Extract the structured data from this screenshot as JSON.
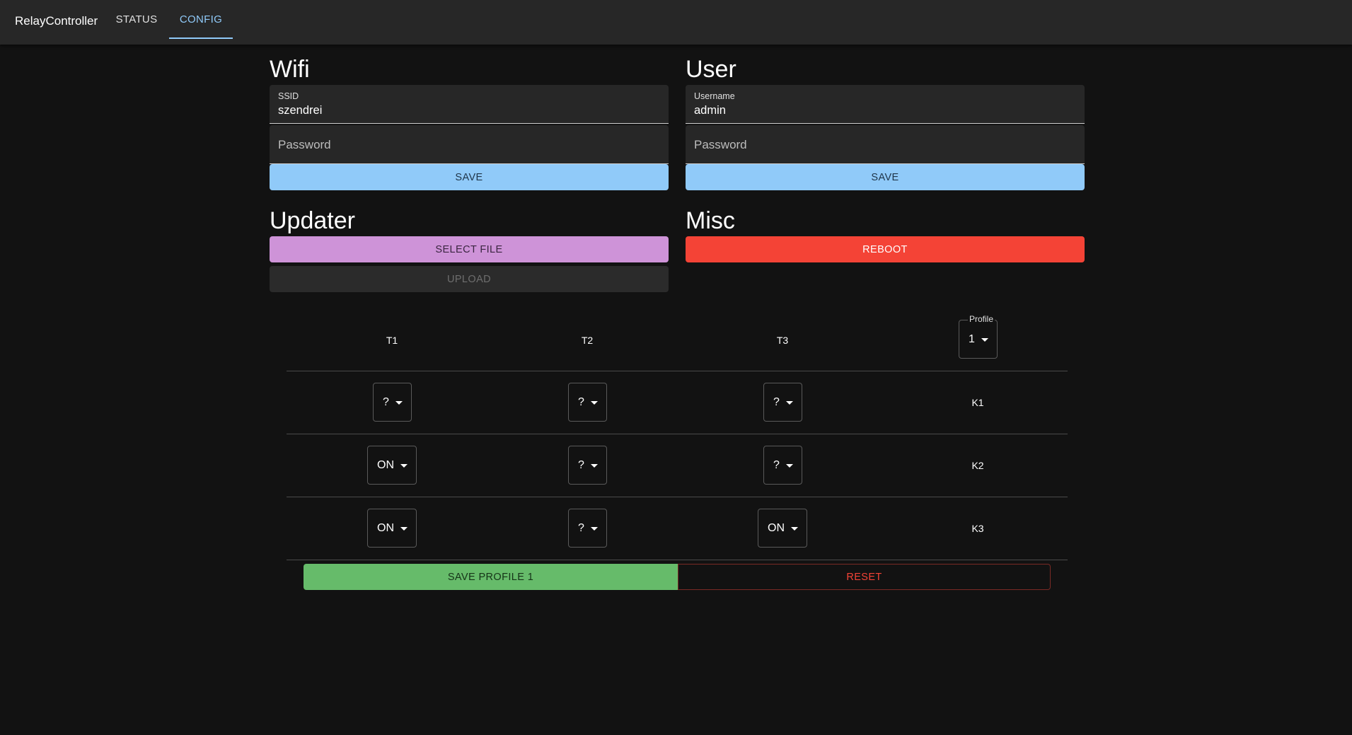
{
  "appbar": {
    "brand": "RelayController",
    "tabs": [
      {
        "label": "STATUS",
        "active": false
      },
      {
        "label": "CONFIG",
        "active": true
      }
    ],
    "accent": "#90caf9"
  },
  "wifi": {
    "title": "Wifi",
    "ssid_label": "SSID",
    "ssid_value": "szendrei",
    "password_placeholder": "Password",
    "save_label": "SAVE"
  },
  "user": {
    "title": "User",
    "username_label": "Username",
    "username_value": "admin",
    "password_placeholder": "Password",
    "save_label": "SAVE"
  },
  "updater": {
    "title": "Updater",
    "select_file_label": "SELECT FILE",
    "upload_label": "UPLOAD"
  },
  "misc": {
    "title": "Misc",
    "reboot_label": "REBOOT"
  },
  "profile_table": {
    "columns": [
      "T1",
      "T2",
      "T3"
    ],
    "profile_label": "Profile",
    "profile_value": "1",
    "rows": [
      {
        "label": "K1",
        "values": [
          "?",
          "?",
          "?"
        ]
      },
      {
        "label": "K2",
        "values": [
          "ON",
          "?",
          "?"
        ]
      },
      {
        "label": "K3",
        "values": [
          "ON",
          "?",
          "ON"
        ]
      }
    ],
    "save_label": "SAVE PROFILE 1",
    "reset_label": "RESET"
  },
  "colors": {
    "background": "#121212",
    "surface": "#272727",
    "primary": "#90caf9",
    "secondary": "#ce93d8",
    "error": "#f44336",
    "success": "#66bb6a"
  }
}
